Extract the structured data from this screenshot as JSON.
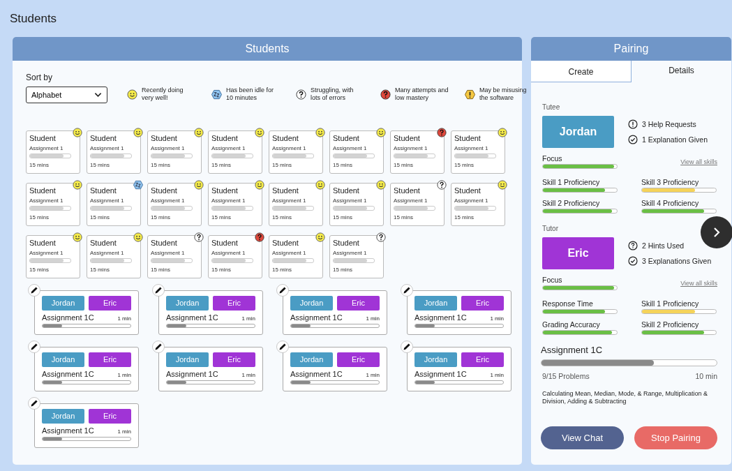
{
  "page_title": "Students",
  "students_panel": {
    "title": "Students",
    "sort_label": "Sort by",
    "sort_value": "Alphabet",
    "legend": [
      {
        "kind": "happy",
        "text": "Recently doing very well!"
      },
      {
        "kind": "idle",
        "text": "Has been idle for 10 minutes"
      },
      {
        "kind": "struggling",
        "text": "Struggling, with lots of errors"
      },
      {
        "kind": "attempts",
        "text": "Many attempts and low mastery"
      },
      {
        "kind": "misuse",
        "text": "May be misusing the software"
      }
    ],
    "students": [
      {
        "name": "Student",
        "assignment": "Assignment 1",
        "time": "15 mins",
        "level": 0.82,
        "kind": "happy"
      },
      {
        "name": "Student",
        "assignment": "Assignment 1",
        "time": "15 mins",
        "level": 0.82,
        "kind": "happy"
      },
      {
        "name": "Student",
        "assignment": "Assignment 1",
        "time": "15 mins",
        "level": 0.82,
        "kind": "happy"
      },
      {
        "name": "Student",
        "assignment": "Assignment 1",
        "time": "15 mins",
        "level": 0.82,
        "kind": "happy"
      },
      {
        "name": "Student",
        "assignment": "Assignment 1",
        "time": "15 mins",
        "level": 0.82,
        "kind": "happy"
      },
      {
        "name": "Student",
        "assignment": "Assignment 1",
        "time": "15 mins",
        "level": 0.82,
        "kind": "happy"
      },
      {
        "name": "Student",
        "assignment": "Assignment 1",
        "time": "15 mins",
        "level": 0.82,
        "kind": "attempts"
      },
      {
        "name": "Student",
        "assignment": "Assignment 1",
        "time": "15 mins",
        "level": 0.82,
        "kind": "happy"
      },
      {
        "name": "Student",
        "assignment": "Assignment 1",
        "time": "15 mins",
        "level": 0.82,
        "kind": "happy"
      },
      {
        "name": "Student",
        "assignment": "Assignment 1",
        "time": "15 mins",
        "level": 0.82,
        "kind": "idle"
      },
      {
        "name": "Student",
        "assignment": "Assignment 1",
        "time": "15 mins",
        "level": 0.82,
        "kind": "happy"
      },
      {
        "name": "Student",
        "assignment": "Assignment 1",
        "time": "15 mins",
        "level": 0.82,
        "kind": "happy"
      },
      {
        "name": "Student",
        "assignment": "Assignment 1",
        "time": "15 mins",
        "level": 0.82,
        "kind": "happy"
      },
      {
        "name": "Student",
        "assignment": "Assignment 1",
        "time": "15 mins",
        "level": 0.82,
        "kind": "happy"
      },
      {
        "name": "Student",
        "assignment": "Assignment 1",
        "time": "15 mins",
        "level": 0.82,
        "kind": "struggling"
      },
      {
        "name": "Student",
        "assignment": "Assignment 1",
        "time": "15 mins",
        "level": 0.82,
        "kind": "happy"
      },
      {
        "name": "Student",
        "assignment": "Assignment 1",
        "time": "15 mins",
        "level": 0.82,
        "kind": "happy"
      },
      {
        "name": "Student",
        "assignment": "Assignment 1",
        "time": "15 mins",
        "level": 0.82,
        "kind": "happy"
      },
      {
        "name": "Student",
        "assignment": "Assignment 1",
        "time": "15 mins",
        "level": 0.82,
        "kind": "struggling"
      },
      {
        "name": "Student",
        "assignment": "Assignment 1",
        "time": "15 mins",
        "level": 0.82,
        "kind": "attempts"
      },
      {
        "name": "Student",
        "assignment": "Assignment 1",
        "time": "15 mins",
        "level": 0.82,
        "kind": "happy"
      },
      {
        "name": "Student",
        "assignment": "Assignment 1",
        "time": "15 mins",
        "level": 0.82,
        "kind": "struggling"
      }
    ],
    "pairs": [
      {
        "tutee": "Jordan",
        "tutor": "Eric",
        "assignment": "Assignment 1C",
        "time": "1 min",
        "level": 0.22
      },
      {
        "tutee": "Jordan",
        "tutor": "Eric",
        "assignment": "Assignment 1C",
        "time": "1 min",
        "level": 0.22
      },
      {
        "tutee": "Jordan",
        "tutor": "Eric",
        "assignment": "Assignment 1C",
        "time": "1 min",
        "level": 0.22
      },
      {
        "tutee": "Jordan",
        "tutor": "Eric",
        "assignment": "Assignment 1C",
        "time": "1 min",
        "level": 0.22
      },
      {
        "tutee": "Jordan",
        "tutor": "Eric",
        "assignment": "Assignment 1C",
        "time": "1 min",
        "level": 0.22
      },
      {
        "tutee": "Jordan",
        "tutor": "Eric",
        "assignment": "Assignment 1C",
        "time": "1 min",
        "level": 0.22
      },
      {
        "tutee": "Jordan",
        "tutor": "Eric",
        "assignment": "Assignment 1C",
        "time": "1 min",
        "level": 0.22
      },
      {
        "tutee": "Jordan",
        "tutor": "Eric",
        "assignment": "Assignment 1C",
        "time": "1 min",
        "level": 0.22
      },
      {
        "tutee": "Jordan",
        "tutor": "Eric",
        "assignment": "Assignment 1C",
        "time": "1 min",
        "level": 0.22
      }
    ]
  },
  "pairing_panel": {
    "title": "Pairing",
    "tabs": [
      {
        "label": "Create",
        "selected": false
      },
      {
        "label": "Details",
        "selected": true
      }
    ],
    "people": [
      {
        "role": "Tutee",
        "name": "Jordan",
        "kind": "tutee",
        "stats": [
          {
            "kind": "alert",
            "text": "3 Help Requests"
          },
          {
            "kind": "check",
            "text": "1 Explanation Given"
          }
        ],
        "focus": {
          "label": "Focus",
          "level": 0.96
        },
        "link": "View all skills",
        "skills": [
          {
            "label": "Skill 1 Proficiency",
            "level": 0.84,
            "color": "#6abf45"
          },
          {
            "label": "Skill 3 Proficiency",
            "level": 0.72,
            "color": "#f5d35a"
          },
          {
            "label": "Skill 2 Proficiency",
            "level": 0.93,
            "color": "#6abf45"
          },
          {
            "label": "Skill 4 Proficiency",
            "level": 0.84,
            "color": "#6abf45"
          }
        ]
      },
      {
        "role": "Tutor",
        "name": "Eric",
        "kind": "tutor",
        "stats": [
          {
            "kind": "hint",
            "text": "2 Hints Used"
          },
          {
            "kind": "check",
            "text": "3 Explanations Given"
          }
        ],
        "focus": {
          "label": "Focus",
          "level": 0.96
        },
        "link": "View all skills",
        "skills": [
          {
            "label": "Response Time",
            "level": 0.84,
            "color": "#6abf45"
          },
          {
            "label": "Skill 1 Proficiency",
            "level": 0.72,
            "color": "#f5d35a"
          },
          {
            "label": "Grading Accuracy",
            "level": 0.93,
            "color": "#6abf45"
          },
          {
            "label": "Skill 2 Proficiency",
            "level": 0.84,
            "color": "#6abf45"
          }
        ]
      }
    ],
    "assignment": {
      "title": "Assignment 1C",
      "level": 0.64,
      "problems": "9/15 Problems",
      "time": "10 min",
      "description": "Calculating Mean, Median, Mode, & Range, Multiplication & Division, Adding & Subtracting"
    },
    "buttons": [
      {
        "kind": "chat",
        "label": "View Chat"
      },
      {
        "kind": "stop",
        "label": "Stop Pairing"
      }
    ]
  }
}
